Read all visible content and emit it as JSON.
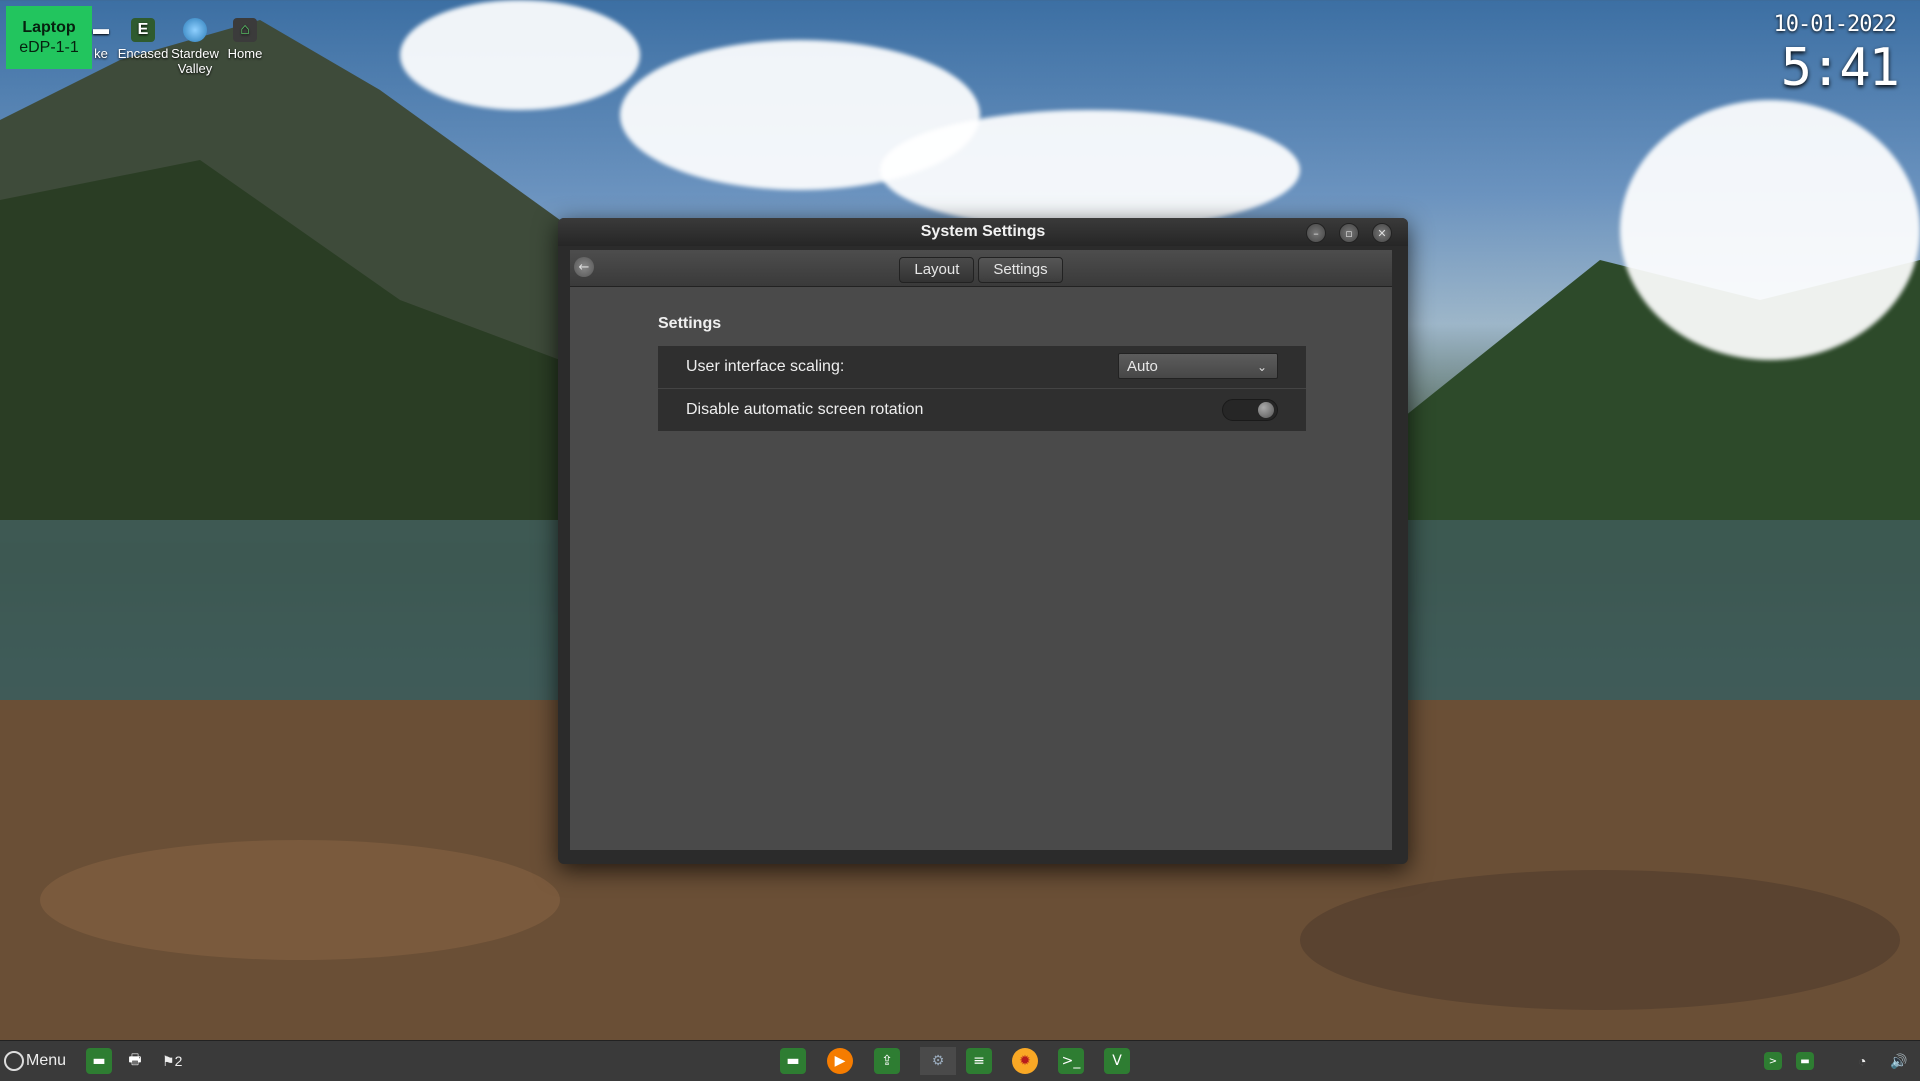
{
  "desktop": {
    "monitor_badge": {
      "line1": "Laptop",
      "line2": "eDP-1-1"
    },
    "icons": [
      {
        "label": "ke",
        "icon": "app-icon"
      },
      {
        "label": "Encased",
        "icon": "encased-icon"
      },
      {
        "label": "Stardew Valley",
        "icon": "stardew-valley-icon"
      },
      {
        "label": "Home",
        "icon": "home-folder-icon"
      }
    ],
    "clock": {
      "date": "10-01-2022",
      "time": "5:41"
    }
  },
  "window": {
    "title": "System Settings",
    "toolbar": {
      "back_icon": "back-arrow-icon",
      "tabs": [
        {
          "label": "Layout",
          "active": false
        },
        {
          "label": "Settings",
          "active": true
        }
      ]
    },
    "section_title": "Settings",
    "settings": {
      "scaling": {
        "label": "User interface scaling:",
        "value": "Auto"
      },
      "rotation": {
        "label": "Disable automatic screen rotation",
        "enabled": false
      }
    }
  },
  "taskbar": {
    "menu_label": "Menu",
    "workspace_count": "2",
    "launchers": [
      "file-manager-icon",
      "media-player-icon",
      "software-center-icon",
      "settings-icon",
      "text-editor-icon",
      "sun-app-icon",
      "terminal-icon",
      "vivaldi-icon"
    ],
    "tray": [
      "terminal-icon",
      "file-manager-icon",
      "wifi-icon",
      "volume-icon"
    ]
  },
  "colors": {
    "badge": "#22c55e",
    "window_bg": "#4a4a4a",
    "settings_box": "#2f2f2f",
    "taskbar": "#3a3a3a"
  }
}
